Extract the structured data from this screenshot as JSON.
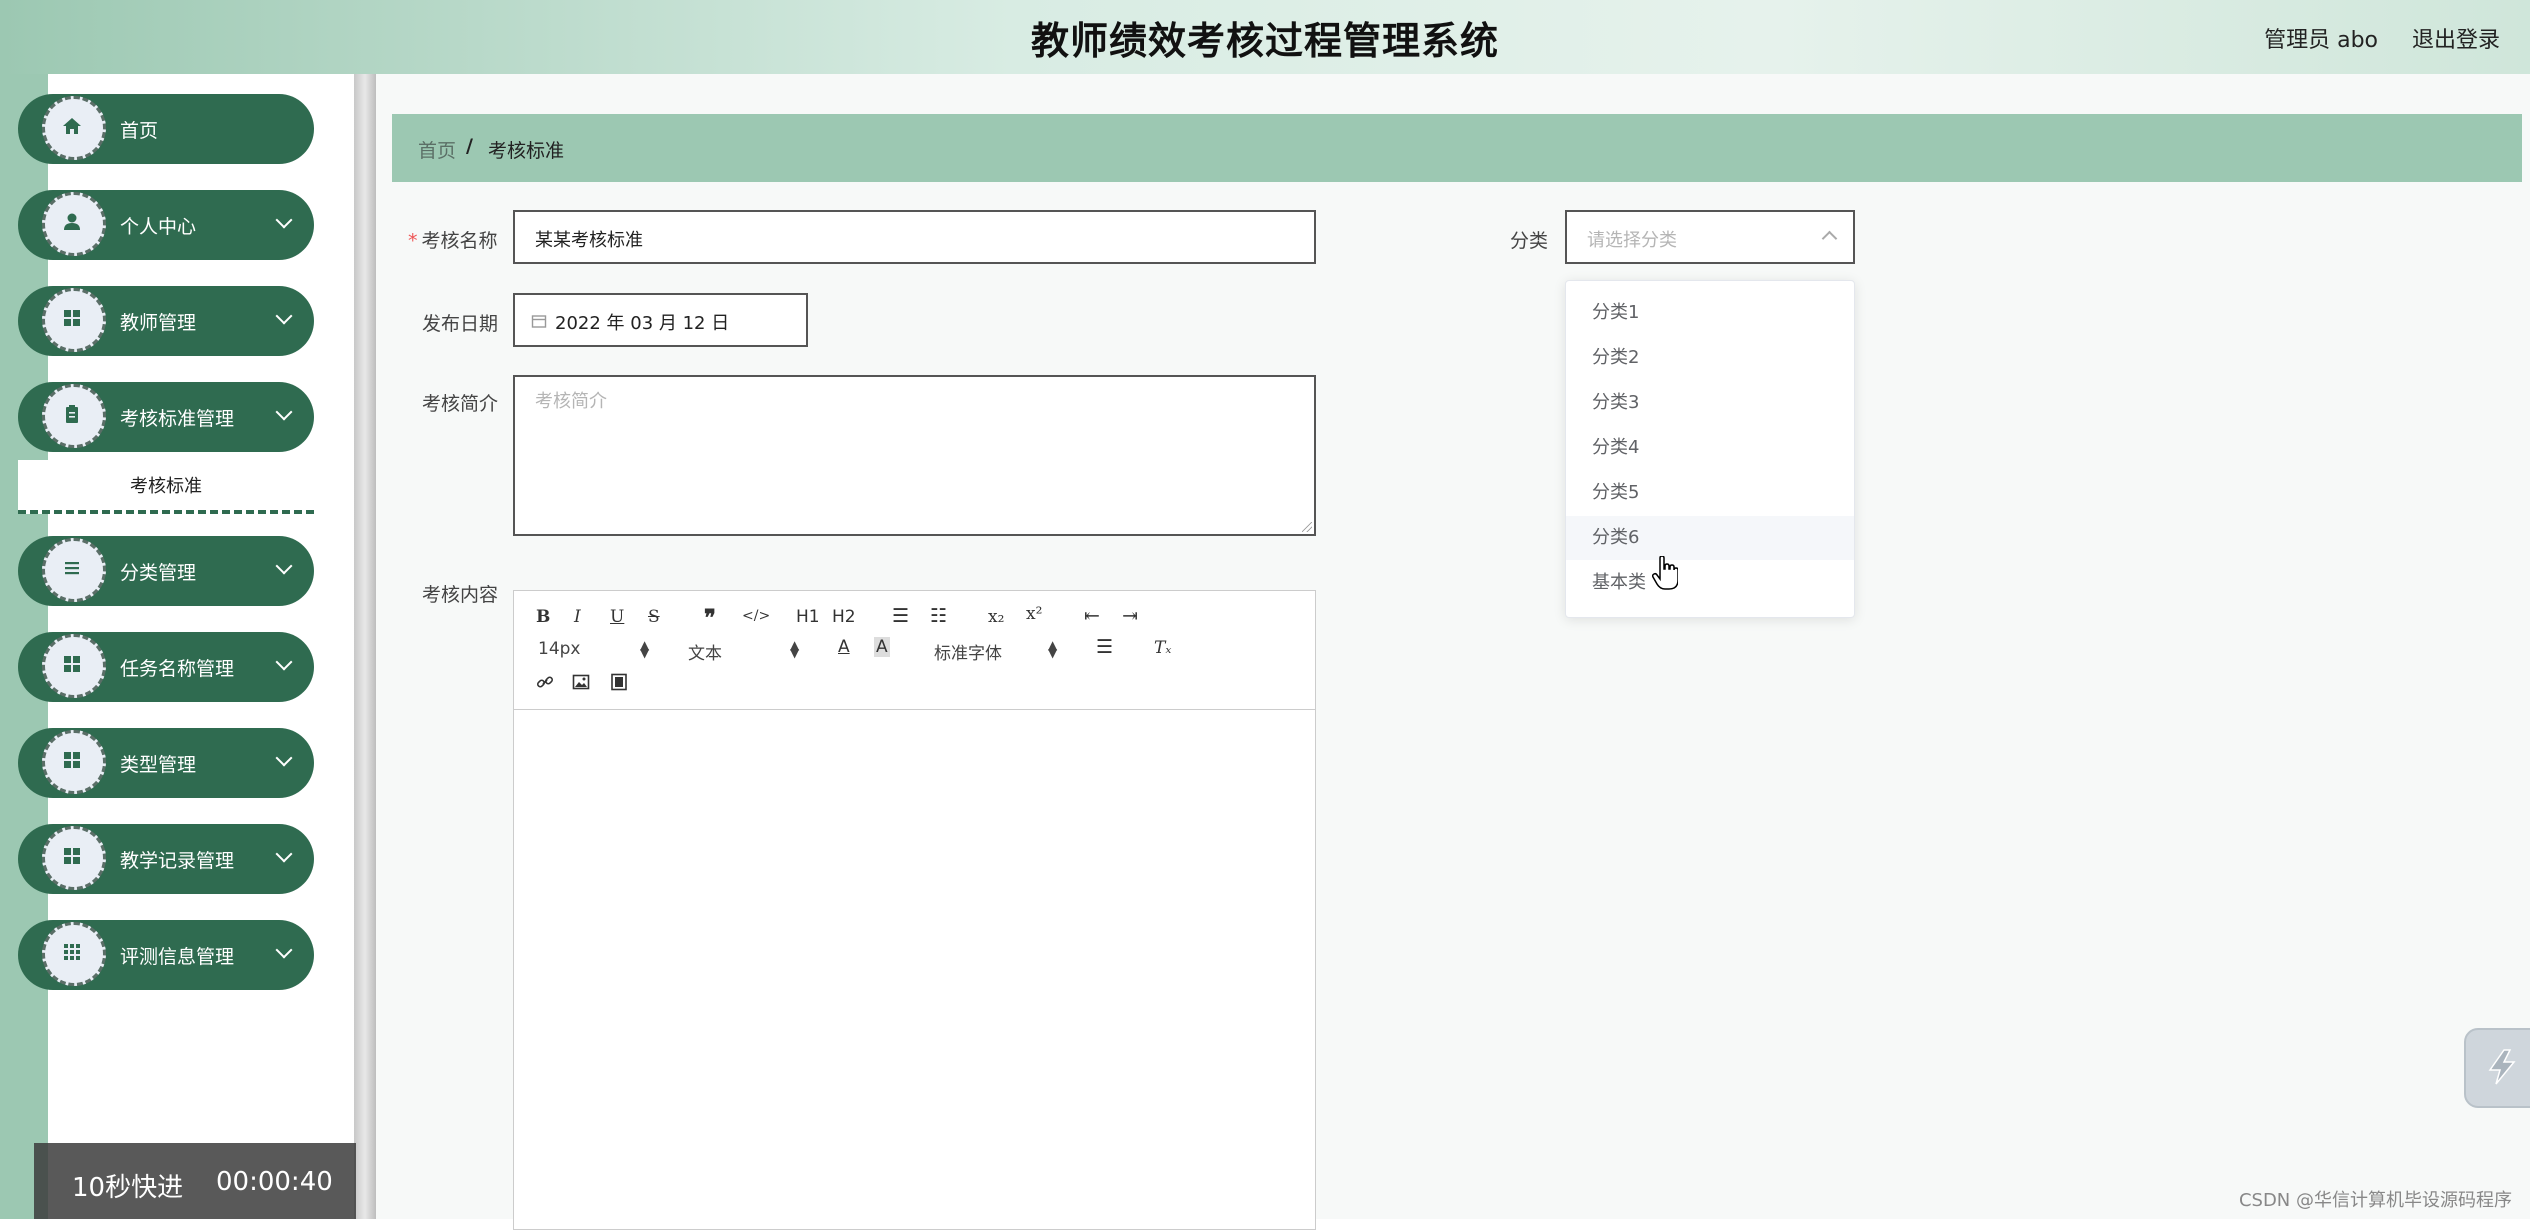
{
  "header": {
    "title": "教师绩效考核过程管理系统",
    "user_label": "管理员 abo",
    "logout_label": "退出登录"
  },
  "sidebar": {
    "items": [
      {
        "label": "首页",
        "icon": "home-icon",
        "has_children": false
      },
      {
        "label": "个人中心",
        "icon": "user-icon",
        "has_children": true
      },
      {
        "label": "教师管理",
        "icon": "grid-icon",
        "has_children": true
      },
      {
        "label": "考核标准管理",
        "icon": "clipboard-icon",
        "has_children": true
      },
      {
        "label": "分类管理",
        "icon": "list-icon",
        "has_children": true
      },
      {
        "label": "任务名称管理",
        "icon": "grid-icon",
        "has_children": true
      },
      {
        "label": "类型管理",
        "icon": "grid-icon",
        "has_children": true
      },
      {
        "label": "教学记录管理",
        "icon": "grid-icon",
        "has_children": true
      },
      {
        "label": "评测信息管理",
        "icon": "apps-icon",
        "has_children": true
      }
    ],
    "submenu_active": "考核标准"
  },
  "breadcrumb": {
    "home": "首页",
    "separator": "/",
    "current": "考核标准"
  },
  "form": {
    "name_label": "考核名称",
    "name_value": "某某考核标准",
    "category_label": "分类",
    "category_placeholder": "请选择分类",
    "date_label": "发布日期",
    "date_value": "2022 年 03 月 12 日",
    "intro_label": "考核简介",
    "intro_placeholder": "考核简介",
    "content_label": "考核内容"
  },
  "dropdown": {
    "options": [
      "分类1",
      "分类2",
      "分类3",
      "分类4",
      "分类5",
      "分类6",
      "基本类"
    ],
    "hovered": "分类6"
  },
  "editor": {
    "font_size": "14px",
    "paragraph": "文本",
    "font_family": "标准字体",
    "buttons": [
      "bold",
      "italic",
      "underline",
      "strike",
      "blockquote",
      "code-block",
      "h1",
      "h2",
      "ordered-list",
      "bullet-list",
      "subscript",
      "superscript",
      "outdent",
      "indent",
      "font-color",
      "background-color",
      "align",
      "clean",
      "link",
      "image",
      "video"
    ],
    "h1_label": "H1",
    "h2_label": "H2"
  },
  "video_bar": {
    "speed_label": "10秒快进",
    "time": "00:00:40"
  },
  "watermark": "CSDN @华信计算机毕设源码程序",
  "colors": {
    "header_green": "#9cc8b2",
    "menu_green": "#2f6b50",
    "breadcrumb_green": "#9cc8b2"
  }
}
